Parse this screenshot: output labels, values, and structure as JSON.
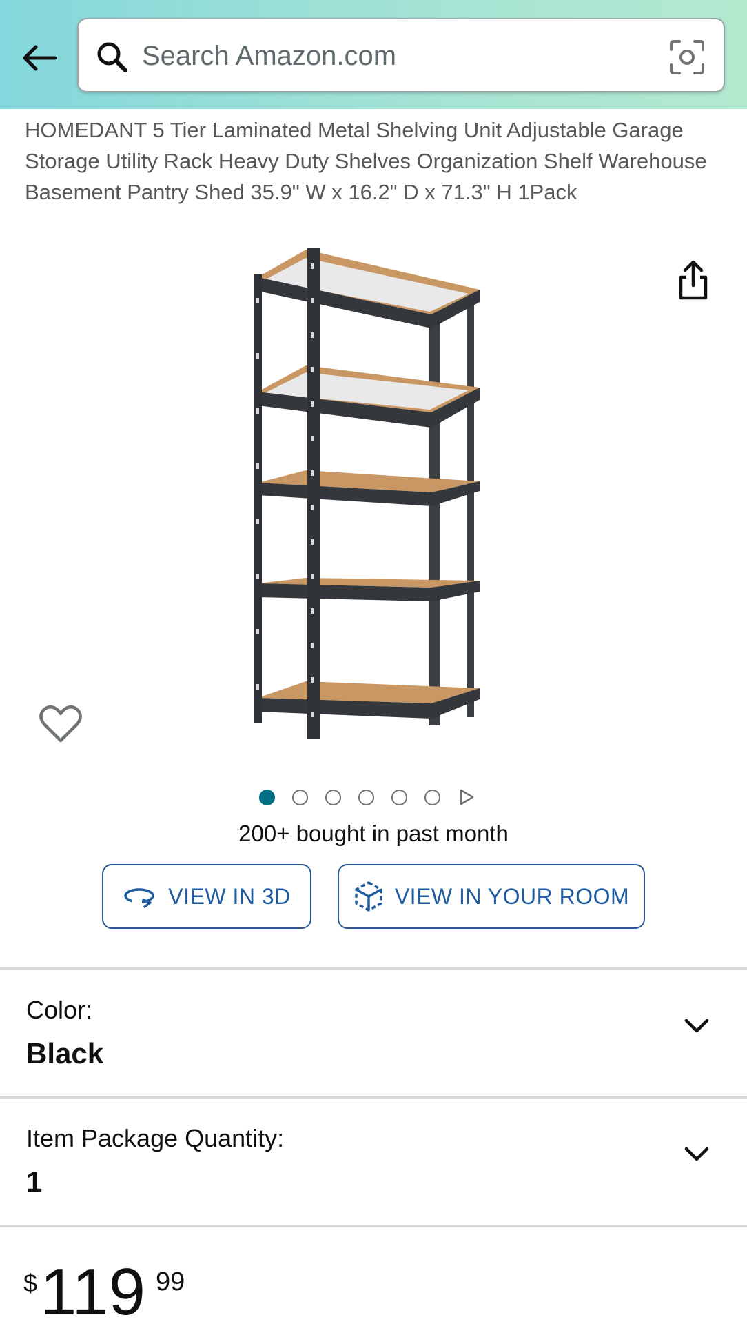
{
  "header": {
    "search_placeholder": "Search Amazon.com",
    "back_icon": "arrow-left-icon",
    "search_icon": "magnifier-icon",
    "camera_icon": "camera-scan-icon"
  },
  "product": {
    "title": "HOMEDANT 5 Tier Laminated Metal Shelving Unit Adjustable Garage Storage Utility Rack Heavy Duty Shelves Organization Shelf Warehouse Basement Pantry Shed 35.9\" W x 16.2\" D x 71.3\" H 1Pack",
    "image_count": 6,
    "active_image_index": 0,
    "bought_text": "200+ bought in past month"
  },
  "buttons": {
    "view_3d": "VIEW IN 3D",
    "view_room": "VIEW IN YOUR ROOM"
  },
  "options": {
    "color_label": "Color:",
    "color_value": "Black",
    "quantity_label": "Item Package Quantity:",
    "quantity_value": "1"
  },
  "price": {
    "symbol": "$",
    "whole": "119",
    "fraction": "99"
  },
  "colors": {
    "accent_teal": "#007185",
    "link_blue": "#1e5a9e",
    "header_gradient_start": "#84d7dc",
    "header_gradient_end": "#b3e9cf"
  }
}
